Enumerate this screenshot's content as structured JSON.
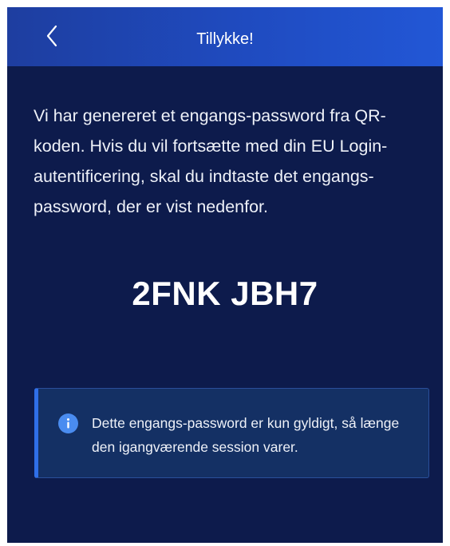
{
  "header": {
    "title": "Tillykke!",
    "back_icon": "chevron-left-icon"
  },
  "message": {
    "text": "Vi har genereret et engangs-password fra QR-koden. Hvis du vil fortsætte med din EU Login-autentificering, skal du indtaste det engangs-password, der er vist nedenfor."
  },
  "otp": {
    "code": "2FNK JBH7"
  },
  "info": {
    "icon": "info-icon",
    "text": "Dette engangs-password er kun gyldigt, så længe den igangværende session varer."
  },
  "colors": {
    "background": "#0d1b4c",
    "header": "#1f4bc0",
    "info_box": "#143064",
    "info_accent": "#2f6fe8",
    "info_icon": "#4a8cf0"
  }
}
